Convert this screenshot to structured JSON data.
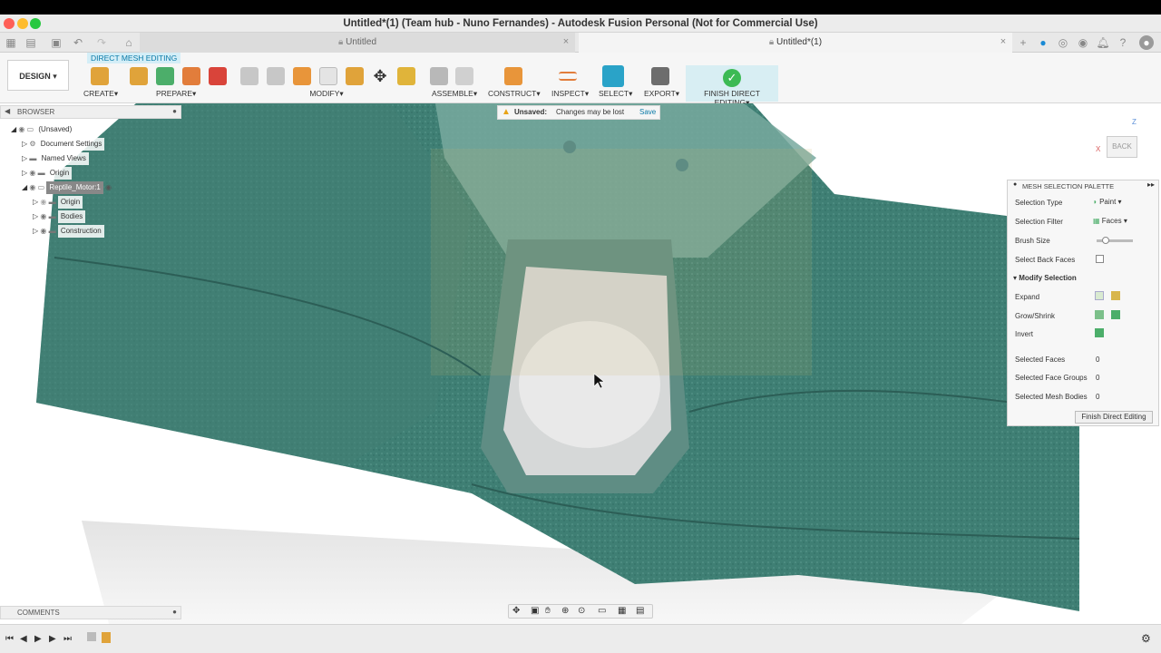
{
  "window": {
    "title": "Untitled*(1) (Team hub - Nuno Fernandes) - Autodesk Fusion Personal (Not for Commercial Use)"
  },
  "tabs": [
    {
      "label": "Untitled"
    },
    {
      "label": "Untitled*(1)"
    }
  ],
  "toolbar": {
    "workspace": "DESIGN",
    "workspace_arrow": "▾",
    "context_tab": "DIRECT MESH EDITING",
    "groups": {
      "create": "CREATE",
      "prepare": "PREPARE",
      "modify": "MODIFY",
      "assemble": "ASSEMBLE",
      "construct": "CONSTRUCT",
      "inspect": "INSPECT",
      "select": "SELECT",
      "export": "EXPORT",
      "finish": "FINISH DIRECT EDITING"
    },
    "dropdown_arrow": "▾"
  },
  "browser": {
    "title": "BROWSER",
    "items": [
      {
        "label": "(Unsaved)"
      },
      {
        "label": "Document Settings"
      },
      {
        "label": "Named Views"
      },
      {
        "label": "Origin"
      },
      {
        "label": "Reptile_Motor:1"
      },
      {
        "label": "Origin"
      },
      {
        "label": "Bodies"
      },
      {
        "label": "Construction"
      }
    ]
  },
  "unsaved": {
    "label": "Unsaved:",
    "message": "Changes may be lost",
    "save": "Save"
  },
  "viewcube": {
    "face": "BACK",
    "axis_z": "Z",
    "axis_x": "X"
  },
  "palette": {
    "title": "MESH SELECTION PALETTE",
    "selection_type_label": "Selection Type",
    "selection_type_value": "Paint",
    "selection_filter_label": "Selection Filter",
    "selection_filter_value": "Faces",
    "brush_size_label": "Brush Size",
    "brush_size_fraction": 0.25,
    "select_back_faces_label": "Select Back Faces",
    "modify_selection_label": "Modify Selection",
    "expand_label": "Expand",
    "grow_shrink_label": "Grow/Shrink",
    "invert_label": "Invert",
    "selected_faces_label": "Selected Faces",
    "selected_faces_value": "0",
    "selected_face_groups_label": "Selected Face Groups",
    "selected_face_groups_value": "0",
    "selected_mesh_bodies_label": "Selected Mesh Bodies",
    "selected_mesh_bodies_value": "0",
    "finish_button": "Finish Direct Editing"
  },
  "comments": {
    "title": "COMMENTS"
  },
  "colors": {
    "mesh": "#3f7f74",
    "accent": "#0a7aa8",
    "finish": "#3cba54"
  }
}
